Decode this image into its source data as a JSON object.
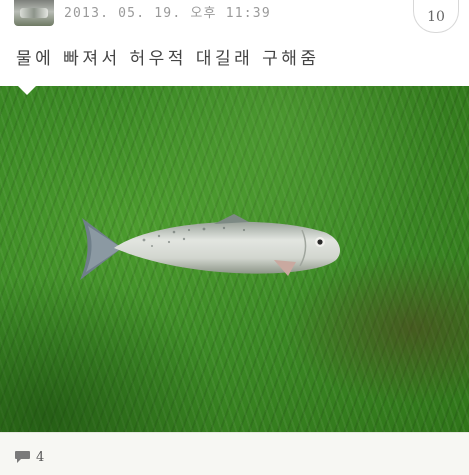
{
  "post": {
    "timestamp": "2013. 05. 19. 오후 11:39",
    "caption": "물에 빠져서 허우적 대길래 구해줌",
    "badge_count": "10",
    "comment_count": "4",
    "avatar_icon": "user-avatar-thumbnail",
    "comment_icon": "speech-bubble-icon"
  },
  "colors": {
    "grass": "#3c8a25",
    "fish_body": "#d9dcd6",
    "text_gray": "#9a9a9a"
  }
}
